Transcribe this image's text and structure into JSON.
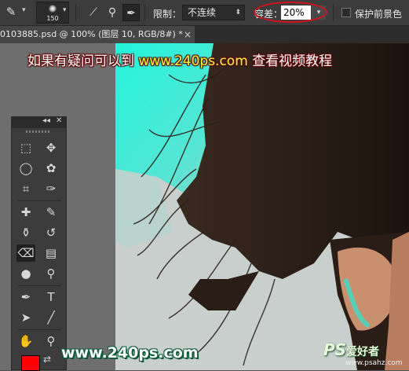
{
  "options_bar": {
    "brush_size": "150",
    "limits_label": "限制：",
    "limits_value": "不连续",
    "tolerance_label": "容差：",
    "tolerance_value": "20%",
    "protect_fg_label": "保护前景色",
    "icons": [
      "background-eraser-icon",
      "sampling-continuous-icon",
      "sampling-once-icon",
      "sampling-swatch-icon"
    ],
    "highlight_color": "#d3111b"
  },
  "document_tab": {
    "title": "0103885.psd @ 100% (图层 10, RGB/8#) *",
    "close": "×"
  },
  "overlay": {
    "prefix": "如果有疑问可以到",
    "url": "www.240ps.com",
    "suffix": "查看视频教程"
  },
  "toolbox": {
    "collapse": "◂◂",
    "close": "✕",
    "foreground_color": "#ff0000"
  },
  "watermark": {
    "url": "www.240ps.com",
    "logo": "PS",
    "logo_cn": "爱好者",
    "logo_site": "www.psahz.com"
  },
  "colors": {
    "cyan_background": "#28f0d8",
    "hair": "#2b1d15",
    "skin": "#c08a6c"
  }
}
